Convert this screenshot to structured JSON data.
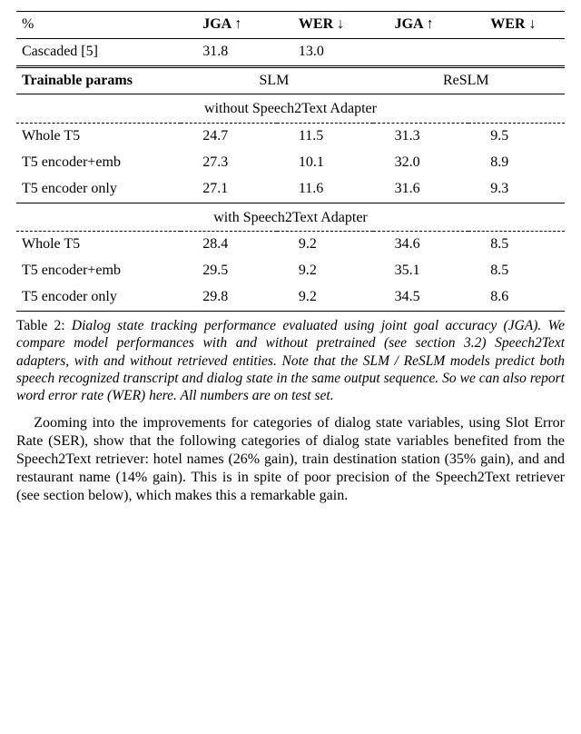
{
  "chart_data": {
    "type": "table",
    "title": "Dialog state tracking performance (JGA / WER)",
    "columns": [
      "Trainable params",
      "SLM JGA ↑",
      "SLM WER ↓",
      "ReSLM JGA ↑",
      "ReSLM WER ↓"
    ],
    "baseline": {
      "label": "Cascaded [5]",
      "jga": 31.8,
      "wer": 13.0
    },
    "sections": [
      {
        "name": "without Speech2Text Adapter",
        "rows": [
          {
            "label": "Whole T5",
            "slm_jga": 24.7,
            "slm_wer": 11.5,
            "reslm_jga": 31.3,
            "reslm_wer": 9.5
          },
          {
            "label": "T5 encoder+emb",
            "slm_jga": 27.3,
            "slm_wer": 10.1,
            "reslm_jga": 32.0,
            "reslm_wer": 8.9
          },
          {
            "label": "T5 encoder only",
            "slm_jga": 27.1,
            "slm_wer": 11.6,
            "reslm_jga": 31.6,
            "reslm_wer": 9.3
          }
        ]
      },
      {
        "name": "with Speech2Text Adapter",
        "rows": [
          {
            "label": "Whole T5",
            "slm_jga": 28.4,
            "slm_wer": 9.2,
            "reslm_jga": 34.6,
            "reslm_wer": 8.5
          },
          {
            "label": "T5 encoder+emb",
            "slm_jga": 29.5,
            "slm_wer": 9.2,
            "reslm_jga": 35.1,
            "reslm_wer": 8.5
          },
          {
            "label": "T5 encoder only",
            "slm_jga": 29.8,
            "slm_wer": 9.2,
            "reslm_jga": 34.5,
            "reslm_wer": 8.6
          }
        ]
      }
    ]
  },
  "header": {
    "percent": "%",
    "jga": "JGA ↑",
    "wer": "WER ↓",
    "trainable": "Trainable params",
    "slm": "SLM",
    "reslm": "ReSLM"
  },
  "baseline": {
    "label": "Cascaded [5]",
    "jga": "31.8",
    "wer": "13.0"
  },
  "sec1": {
    "title": "without Speech2Text Adapter",
    "r0": {
      "label": "Whole T5",
      "c1": "24.7",
      "c2": "11.5",
      "c3": "31.3",
      "c4": "9.5"
    },
    "r1": {
      "label": "T5 encoder+emb",
      "c1": "27.3",
      "c2": "10.1",
      "c3": "32.0",
      "c4": "8.9"
    },
    "r2": {
      "label": "T5 encoder only",
      "c1": "27.1",
      "c2": "11.6",
      "c3": "31.6",
      "c4": "9.3"
    }
  },
  "sec2": {
    "title": "with Speech2Text Adapter",
    "r0": {
      "label": "Whole T5",
      "c1": "28.4",
      "c2": "9.2",
      "c3": "34.6",
      "c4": "8.5"
    },
    "r1": {
      "label": "T5 encoder+emb",
      "c1": "29.5",
      "c2": "9.2",
      "c3": "35.1",
      "c4": "8.5"
    },
    "r2": {
      "label": "T5 encoder only",
      "c1": "29.8",
      "c2": "9.2",
      "c3": "34.5",
      "c4": "8.6"
    }
  },
  "caption": {
    "label": "Table 2:",
    "text": " Dialog state tracking performance evaluated using joint goal accuracy (JGA). We compare model performances with and without pretrained (see section 3.2) Speech2Text adapters, with and without retrieved entities. Note that the SLM / ReSLM models predict both speech recognized transcript and dialog state in the same output sequence. So we can also report word error rate (WER) here. All numbers are on test set."
  },
  "paragraph": "Zooming into the improvements for categories of dialog state variables, using Slot Error Rate (SER), show that the following categories of dialog state variables benefited from the Speech2Text retriever: hotel names (26% gain), train destination station (35% gain), and and restaurant name (14% gain). This is in spite of poor precision of the Speech2Text retriever (see section below), which makes this a remarkable gain."
}
